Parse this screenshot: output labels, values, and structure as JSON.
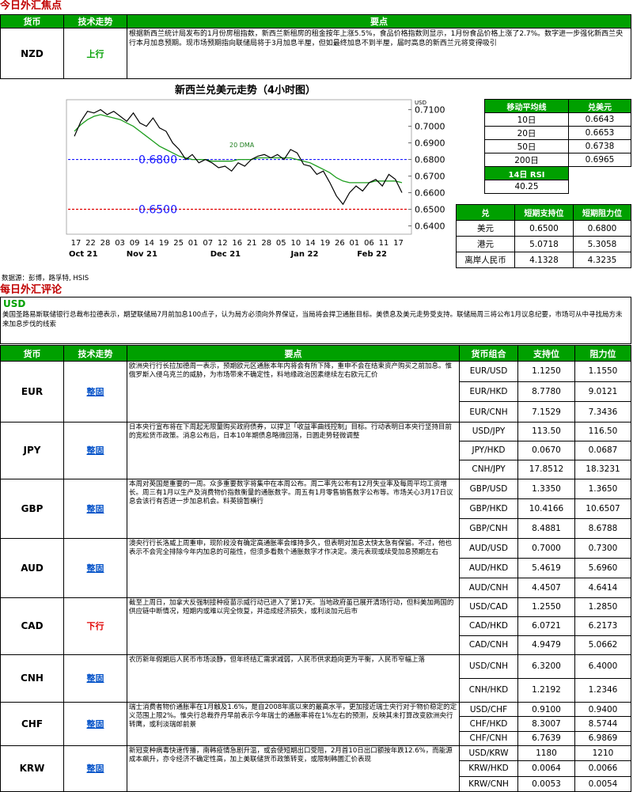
{
  "focus_title": "今日外汇焦点",
  "comment_title": "每日外汇评论",
  "headers": {
    "currency": "货币",
    "trend": "技术走势",
    "points": "要点",
    "pair": "货币组合",
    "support": "支持位",
    "resistance": "阻力位"
  },
  "focus": {
    "currency": "NZD",
    "trend": "上行",
    "points": "根据新西兰统计局发布的1月份房租指数，新西兰新租房的租金按年上涨5.5%，食品价格指数则显示，1月份食品价格上涨了2.7%。数字进一步强化新西兰央行本月加息预期。现市场预期指向联储局将于3月加息半厘，但如最终加息不到半厘，届时高息的新西兰元将变得吸引"
  },
  "chart": {
    "title": "新西兰兑美元走势（4小时图）",
    "unit": "USD",
    "ma_label": "20 DMA",
    "line_label_high": "0.6800",
    "line_label_low": "0.6500",
    "y_ticks": [
      "0.7100",
      "0.7000",
      "0.6900",
      "0.6800",
      "0.6700",
      "0.6600",
      "0.6500",
      "0.6400"
    ],
    "x_ticks": [
      "17",
      "22",
      "28",
      "03",
      "09",
      "14",
      "19",
      "25",
      "01",
      "07",
      "12",
      "16",
      "21",
      "28",
      "05",
      "10",
      "14",
      "19",
      "26",
      "01",
      "06",
      "11",
      "17"
    ],
    "months": [
      "Oct 21",
      "Nov 21",
      "Dec 21",
      "Jan 22",
      "Feb 22"
    ],
    "source": "数据源：彭博，路孚特, HSIS"
  },
  "chart_data": {
    "type": "line",
    "title": "新西兰兑美元走势（4小时图）",
    "ylabel": "USD",
    "ylim": [
      0.635,
      0.716
    ],
    "series": [
      {
        "name": "",
        "values": [
          0.694,
          0.703,
          0.709,
          0.708,
          0.71,
          0.707,
          0.709,
          0.706,
          0.703,
          0.708,
          0.702,
          0.7,
          0.705,
          0.699,
          0.697,
          0.69,
          0.686,
          0.68,
          0.683,
          0.678,
          0.68,
          0.678,
          0.675,
          0.676,
          0.673,
          0.678,
          0.676,
          0.68,
          0.682,
          0.683,
          0.681,
          0.683,
          0.68,
          0.686,
          0.684,
          0.677,
          0.676,
          0.671,
          0.673,
          0.666,
          0.658,
          0.653,
          0.66,
          0.664,
          0.661,
          0.666,
          0.668,
          0.664,
          0.671,
          0.668,
          0.66
        ]
      },
      {
        "name": "20 DMA",
        "values": [
          0.697,
          0.701,
          0.704,
          0.706,
          0.707,
          0.706,
          0.705,
          0.704,
          0.702,
          0.7,
          0.697,
          0.694,
          0.691,
          0.688,
          0.686,
          0.684,
          0.682,
          0.681,
          0.68,
          0.68,
          0.68,
          0.679,
          0.679,
          0.679,
          0.679,
          0.68,
          0.68,
          0.68,
          0.681,
          0.681,
          0.681,
          0.681,
          0.681,
          0.681,
          0.68,
          0.679,
          0.678,
          0.676,
          0.674,
          0.672,
          0.669,
          0.667,
          0.666,
          0.666,
          0.666,
          0.666,
          0.667,
          0.667,
          0.667,
          0.667,
          0.666
        ]
      }
    ],
    "hlines": [
      0.68,
      0.65
    ]
  },
  "ma": {
    "header": [
      "移动平均线",
      "兑美元"
    ],
    "rows": [
      [
        "10日",
        "0.6643"
      ],
      [
        "20日",
        "0.6653"
      ],
      [
        "50日",
        "0.6738"
      ],
      [
        "200日",
        "0.6965"
      ]
    ],
    "rsi_label": "14日 RSI",
    "rsi_value": "40.25"
  },
  "sr": {
    "header": [
      "兑",
      "短期支持位",
      "短期阻力位"
    ],
    "rows": [
      [
        "美元",
        "0.6500",
        "0.6800"
      ],
      [
        "港元",
        "5.0718",
        "5.3058"
      ],
      [
        "离岸人民币",
        "4.1328",
        "4.3235"
      ]
    ]
  },
  "usd": {
    "label": "USD",
    "text": "美国圣路易斯联储银行总裁布拉德表示，期望联储局7月前加息100点子，认为局方必须向外界保证，当局将会捍卫通胀目标。美债息及美元走势受支持。联储局周三将公布1月议息纪要，市场可从中寻找局方未来加息步伐的线索"
  },
  "rows": [
    {
      "currency": "EUR",
      "trend": "整固",
      "trend_type": "flat",
      "points": "欧洲央行行长拉加德周一表示，预期欧元区通胀本年内将会有所下降，重申不会在结束资产购买之前加息。惟俄罗斯入侵乌克兰的威胁，为市场带来不确定性，料地缘政治因素继续左右欧元汇价",
      "pairs": [
        [
          "EUR/USD",
          "1.1250",
          "1.1550"
        ],
        [
          "EUR/HKD",
          "8.7780",
          "9.0121"
        ],
        [
          "EUR/CNH",
          "7.1529",
          "7.3436"
        ]
      ]
    },
    {
      "currency": "JPY",
      "trend": "整固",
      "trend_type": "flat",
      "points": "日本央行宣布将在下周起无限量购买政府债券，以捍卫「收益率曲线控制」目标。行动表明日本央行坚持目前的宽松货币政策。消息公布后，日本10年期债息略微回落，日圆走势轻微调整",
      "pairs": [
        [
          "USD/JPY",
          "113.50",
          "116.50"
        ],
        [
          "JPY/HKD",
          "0.0670",
          "0.0687"
        ],
        [
          "CNH/JPY",
          "17.8512",
          "18.3231"
        ]
      ]
    },
    {
      "currency": "GBP",
      "trend": "整固",
      "trend_type": "flat",
      "points": "本周对英国是重要的一周。众多重要数字将集中在本周公布。周二率先公布有12月失业率及每周平均工资增长。周三有1月以生产及消费物价指数衡量的通胀数字。周五有1月零售销售数字公布等。市场关心3月17日议息会该行有否进一步加息机会。料英镑暂横行",
      "pairs": [
        [
          "GBP/USD",
          "1.3350",
          "1.3650"
        ],
        [
          "GBP/HKD",
          "10.4166",
          "10.6507"
        ],
        [
          "GBP/CNH",
          "8.4881",
          "8.6788"
        ]
      ]
    },
    {
      "currency": "AUD",
      "trend": "整固",
      "trend_type": "flat",
      "points": "澳央行行长洛威上周重申，现阶段没有确定高通胀率会维持多久，但表明对加息太快太急有保留。不过，他也表示不会完全排除今年内加息的可能性，但须多看数个通胀数字才作决定。澳元表现或续受加息预期左右",
      "pairs": [
        [
          "AUD/USD",
          "0.7000",
          "0.7300"
        ],
        [
          "AUD/HKD",
          "5.4619",
          "5.6960"
        ],
        [
          "AUD/CNH",
          "4.4507",
          "4.6414"
        ]
      ]
    },
    {
      "currency": "CAD",
      "trend": "下行",
      "trend_type": "down",
      "points": "截至上周日，加拿大反强制接种疫苗示威行动已进入了第17天。当地政府虽已展开清场行动，但料美加两国的供应链中断情况，短期内或难以完全恢复，并造成经济损失，或利淡加元后市",
      "pairs": [
        [
          "USD/CAD",
          "1.2550",
          "1.2850"
        ],
        [
          "CAD/HKD",
          "6.0721",
          "6.2173"
        ],
        [
          "CAD/CNH",
          "4.9479",
          "5.0662"
        ]
      ]
    },
    {
      "currency": "CNH",
      "trend": "整固",
      "trend_type": "flat",
      "points": "农历新年假期后人民币市场淡静，但年终结汇需求减弱，人民币供求趋向更为平衡，人民币窄幅上落",
      "pairs": [
        [
          "USD/CNH",
          "6.3200",
          "6.4000"
        ],
        [
          "CNH/HKD",
          "1.2192",
          "1.2346"
        ]
      ]
    },
    {
      "currency": "CHF",
      "trend": "整固",
      "trend_type": "flat",
      "points": "瑞士消费者物价通胀率在1月触及1.6%，是自2008年底以来的最高水平，更加接近瑞士央行对于物价稳定的定义范围上限2%。惟央行总裁乔丹早前表示今年瑞士的通胀率将在1%左右的预测，反映其未打算改变欧洲央行转鹰，或利淡瑞郎前景",
      "pairs": [
        [
          "USD/CHF",
          "0.9100",
          "0.9400"
        ],
        [
          "CHF/HKD",
          "8.3007",
          "8.5744"
        ],
        [
          "CHF/CNH",
          "6.7639",
          "6.9869"
        ]
      ]
    },
    {
      "currency": "KRW",
      "trend": "整固",
      "trend_type": "flat",
      "points": "新冠变种病毒快速传播，南韩疫情急剧升温，或会使短期出口受阻，2月首10日出口额按年跌12.6%，而能源成本飙升，亦令经济不确定性高，加上美联储货币政策转变，或限制韩圜汇价表现",
      "pairs": [
        [
          "USD/KRW",
          "1180",
          "1210"
        ],
        [
          "KRW/HKD",
          "0.0064",
          "0.0066"
        ],
        [
          "KRW/CNH",
          "0.0053",
          "0.0054"
        ]
      ]
    }
  ]
}
